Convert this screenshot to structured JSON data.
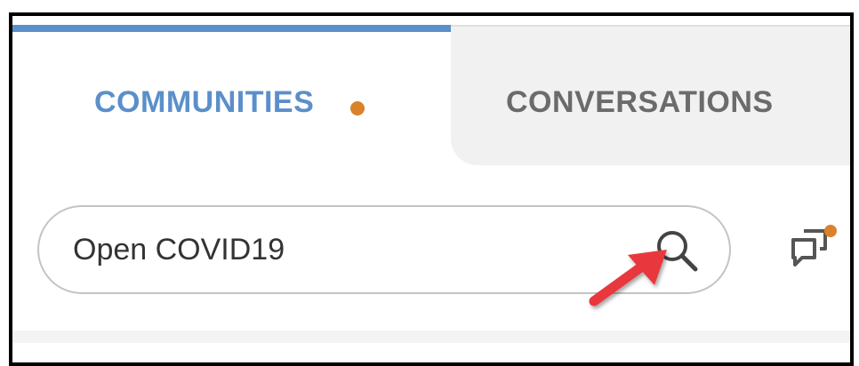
{
  "tabs": [
    {
      "label": "COMMUNITIES",
      "active": true,
      "has_notification_dot": true
    },
    {
      "label": "CONVERSATIONS",
      "active": false
    }
  ],
  "search": {
    "value": "Open COVID19",
    "icon": "magnifier-icon"
  },
  "annotation": {
    "icon": "red-arrow-icon",
    "color": "#e8383d"
  },
  "actions": {
    "chat_icon": "chat-bubbles-icon",
    "has_notification_dot": true
  },
  "colors": {
    "accent": "#5b8fca",
    "notification": "#d9822b",
    "inactive_text": "#6b6b6b",
    "arrow": "#e8383d"
  }
}
